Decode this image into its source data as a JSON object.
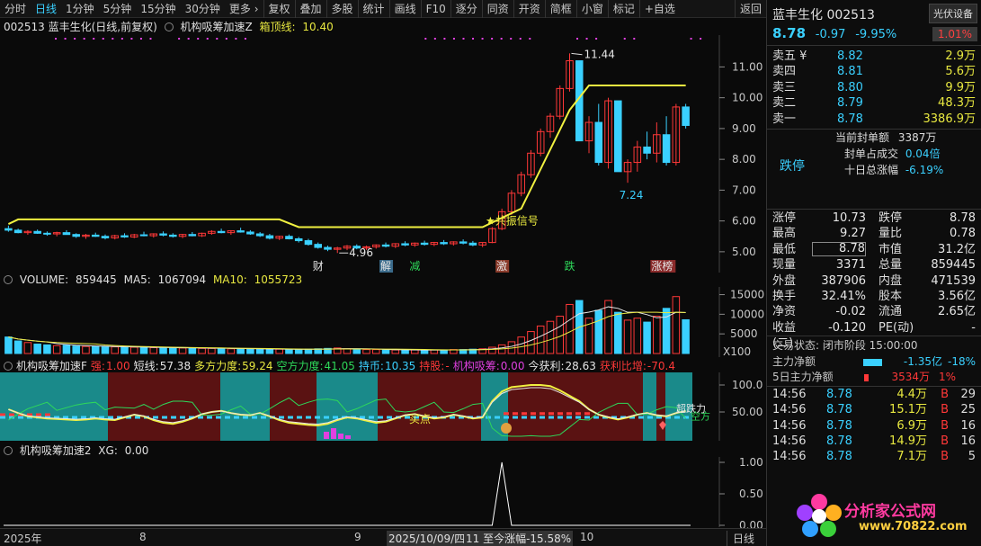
{
  "toolbar": {
    "items": [
      "分时",
      "日线",
      "1分钟",
      "5分钟",
      "15分钟",
      "30分钟",
      "更多 ›",
      "复权",
      "叠加",
      "多股",
      "统计",
      "画线",
      "F10",
      "逐分",
      "同资",
      "开资",
      "简框",
      "小窗",
      "标记",
      "+自选",
      "返回"
    ],
    "active_index": 1
  },
  "main_title": {
    "stock": "002513 蓝丰生化(日线,前复权)",
    "indicator": "机构吸筹加速Z",
    "box_top_label": "箱顶线:",
    "box_top_value": "10.40"
  },
  "price_chart": {
    "y_ticks": [
      "11.00",
      "10.00",
      "9.00",
      "8.00",
      "7.00",
      "6.00",
      "5.00"
    ],
    "high_label": "11.44",
    "low_label": "4.96",
    "low_label2": "7.24",
    "signal_label": "★共振信号",
    "markers": [
      "财",
      "解",
      "减",
      "激",
      "跌",
      "涨榜"
    ]
  },
  "volume_panel": {
    "label": "VOLUME:",
    "value": "859445",
    "ma5_label": "MA5:",
    "ma5_value": "1067094",
    "ma10_label": "MA10:",
    "ma10_value": "1055723",
    "y_ticks": [
      "15000",
      "10000",
      "5000"
    ],
    "unit": "X100"
  },
  "indicator_panel": {
    "name": "机构吸筹加速F",
    "items": [
      {
        "label": "强:",
        "value": "1.00",
        "color": "#ff3838"
      },
      {
        "label": "短线:",
        "value": "57.38",
        "color": "#e6e6e6"
      },
      {
        "label": "多方力度:",
        "value": "59.24",
        "color": "#e8e840"
      },
      {
        "label": "空方力度:",
        "value": "41.05",
        "color": "#2ed85a"
      },
      {
        "label": "持币:",
        "value": "10.35",
        "color": "#3ad0ff"
      },
      {
        "label": "持股:",
        "value": "-",
        "color": "#ff3838"
      },
      {
        "label": "机构吸筹:",
        "value": "0.00",
        "color": "#e040e0"
      },
      {
        "label": "今获利:",
        "value": "28.63",
        "color": "#e6e6e6"
      },
      {
        "label": "获利比增:",
        "value": "-70.4",
        "color": "#ff3838"
      }
    ],
    "y_ticks": [
      "100.0",
      "50.00"
    ],
    "buy_label": "买点",
    "tag1": "超跌力",
    "tag2": "空方"
  },
  "xg_panel": {
    "name": "机构吸筹加速2",
    "label": "XG:",
    "value": "0.00",
    "y_ticks": [
      "1.00",
      "0.50",
      "0.00"
    ]
  },
  "xaxis": {
    "labels": [
      "2025年",
      "8",
      "9",
      "2025/10/09/四",
      "11 至今涨幅-15.58%",
      "10"
    ],
    "period": "日线"
  },
  "quote": {
    "name": "蓝丰生化 002513",
    "sector": "光伏设备",
    "price": "8.78",
    "change": "-0.97",
    "change_pct": "-9.95%",
    "badge_pct": "1.01%",
    "asks": [
      {
        "label": "卖五 ¥",
        "price": "8.82",
        "vol": "2.9万"
      },
      {
        "label": "卖四",
        "price": "8.81",
        "vol": "5.6万"
      },
      {
        "label": "卖三",
        "price": "8.80",
        "vol": "9.9万"
      },
      {
        "label": "卖二",
        "price": "8.79",
        "vol": "48.3万"
      },
      {
        "label": "卖一",
        "price": "8.78",
        "vol": "3386.9万"
      }
    ],
    "seal_label": "当前封单额",
    "seal_value": "3387万",
    "seal_ratio_label": "封单占成交",
    "seal_ratio_value": "0.04倍",
    "ten_day_label": "十日总涨幅",
    "ten_day_value": "-6.19%",
    "status": "跌停",
    "stats": [
      [
        "涨停",
        "10.73",
        "跌停",
        "8.78"
      ],
      [
        "最高",
        "9.27",
        "量比",
        "0.78"
      ],
      [
        "最低",
        "8.78",
        "市值",
        "31.2亿"
      ],
      [
        "现量",
        "3371",
        "总量",
        "859445"
      ],
      [
        "外盘",
        "387906",
        "内盘",
        "471539"
      ],
      [
        "换手",
        "32.41%",
        "股本",
        "3.56亿"
      ],
      [
        "净资",
        "-0.02",
        "流通",
        "2.65亿"
      ],
      [
        "收益(二)",
        "-0.120",
        "PE(动)",
        "-"
      ]
    ],
    "trade_state": "交易状态: 闭市阶段 15:00:00",
    "main_flow_label": "主力净额",
    "main_flow_value": "-1.35亿",
    "main_flow_pct": "-18%",
    "five_day_label": "5日主力净额",
    "five_day_value": "3534万",
    "five_day_pct": "1%",
    "ticks": [
      [
        "14:56",
        "8.78",
        "4.4万",
        "B",
        "29"
      ],
      [
        "14:56",
        "8.78",
        "15.1万",
        "B",
        "25"
      ],
      [
        "14:56",
        "8.78",
        "6.9万",
        "B",
        "16"
      ],
      [
        "14:56",
        "8.78",
        "14.9万",
        "B",
        "16"
      ],
      [
        "14:56",
        "8.78",
        "7.1万",
        "B",
        "5"
      ]
    ],
    "watermark": "分析家公式网",
    "watermark_url": "www.70822.com"
  },
  "chart_data": {
    "type": "candlestick",
    "y_ticks": [
      "11.00",
      "10.00",
      "9.00",
      "8.00",
      "7.00",
      "6.00",
      "5.00"
    ],
    "ylim": [
      4.5,
      11.8
    ],
    "candles": [
      [
        5.75,
        5.85,
        5.65,
        5.7
      ],
      [
        5.7,
        5.75,
        5.6,
        5.62
      ],
      [
        5.62,
        5.7,
        5.55,
        5.66
      ],
      [
        5.66,
        5.72,
        5.58,
        5.6
      ],
      [
        5.6,
        5.66,
        5.52,
        5.58
      ],
      [
        5.58,
        5.65,
        5.5,
        5.62
      ],
      [
        5.62,
        5.7,
        5.55,
        5.56
      ],
      [
        5.56,
        5.6,
        5.45,
        5.5
      ],
      [
        5.5,
        5.58,
        5.42,
        5.54
      ],
      [
        5.54,
        5.62,
        5.48,
        5.5
      ],
      [
        5.5,
        5.56,
        5.4,
        5.45
      ],
      [
        5.45,
        5.55,
        5.4,
        5.52
      ],
      [
        5.52,
        5.6,
        5.45,
        5.48
      ],
      [
        5.48,
        5.58,
        5.44,
        5.55
      ],
      [
        5.55,
        5.65,
        5.5,
        5.52
      ],
      [
        5.52,
        5.6,
        5.46,
        5.58
      ],
      [
        5.58,
        5.66,
        5.5,
        5.54
      ],
      [
        5.54,
        5.6,
        5.46,
        5.5
      ],
      [
        5.5,
        5.58,
        5.44,
        5.56
      ],
      [
        5.56,
        5.64,
        5.5,
        5.52
      ],
      [
        5.52,
        5.62,
        5.48,
        5.6
      ],
      [
        5.6,
        5.7,
        5.55,
        5.66
      ],
      [
        5.66,
        5.75,
        5.6,
        5.62
      ],
      [
        5.62,
        5.7,
        5.55,
        5.68
      ],
      [
        5.68,
        5.78,
        5.62,
        5.64
      ],
      [
        5.64,
        5.7,
        5.55,
        5.58
      ],
      [
        5.58,
        5.64,
        5.48,
        5.52
      ],
      [
        5.52,
        5.58,
        5.4,
        5.44
      ],
      [
        5.44,
        5.52,
        5.38,
        5.5
      ],
      [
        5.5,
        5.56,
        5.4,
        5.42
      ],
      [
        5.42,
        5.48,
        5.3,
        5.36
      ],
      [
        5.36,
        5.42,
        5.2,
        5.24
      ],
      [
        5.24,
        5.3,
        5.1,
        5.14
      ],
      [
        5.14,
        5.2,
        5.02,
        5.08
      ],
      [
        5.08,
        5.16,
        4.96,
        5.12
      ],
      [
        5.12,
        5.22,
        5.05,
        5.18
      ],
      [
        5.18,
        5.24,
        5.08,
        5.12
      ],
      [
        5.12,
        5.2,
        5.06,
        5.16
      ],
      [
        5.16,
        5.24,
        5.1,
        5.22
      ],
      [
        5.22,
        5.3,
        5.14,
        5.18
      ],
      [
        5.18,
        5.28,
        5.12,
        5.26
      ],
      [
        5.26,
        5.34,
        5.18,
        5.22
      ],
      [
        5.22,
        5.3,
        5.16,
        5.28
      ],
      [
        5.28,
        5.36,
        5.2,
        5.24
      ],
      [
        5.24,
        5.32,
        5.18,
        5.3
      ],
      [
        5.3,
        5.38,
        5.22,
        5.26
      ],
      [
        5.26,
        5.34,
        5.2,
        5.32
      ],
      [
        5.32,
        5.4,
        5.24,
        5.28
      ],
      [
        5.28,
        5.35,
        5.18,
        5.22
      ],
      [
        5.22,
        5.3,
        5.15,
        5.3
      ],
      [
        5.3,
        5.8,
        5.28,
        5.75
      ],
      [
        5.75,
        6.4,
        5.7,
        6.3
      ],
      [
        6.3,
        7.0,
        6.2,
        6.9
      ],
      [
        6.9,
        7.6,
        6.8,
        7.5
      ],
      [
        7.5,
        8.3,
        7.4,
        8.2
      ],
      [
        8.2,
        9.0,
        8.1,
        8.9
      ],
      [
        8.9,
        9.5,
        8.7,
        9.4
      ],
      [
        9.4,
        10.4,
        9.3,
        10.3
      ],
      [
        10.3,
        11.44,
        10.2,
        11.2
      ],
      [
        11.2,
        10.4,
        8.6,
        8.6
      ],
      [
        8.6,
        9.4,
        8.2,
        9.2
      ],
      [
        9.2,
        9.8,
        7.8,
        7.9
      ],
      [
        7.9,
        10.0,
        7.7,
        9.9
      ],
      [
        9.9,
        8.2,
        7.6,
        7.6
      ],
      [
        7.6,
        8.0,
        7.24,
        7.9
      ],
      [
        7.9,
        8.6,
        7.6,
        8.4
      ],
      [
        8.4,
        8.9,
        8.0,
        8.2
      ],
      [
        8.2,
        9.2,
        7.9,
        8.8
      ],
      [
        8.8,
        9.4,
        7.8,
        7.9
      ],
      [
        7.9,
        9.8,
        7.8,
        9.7
      ],
      [
        9.7,
        9.8,
        9.0,
        9.1
      ]
    ],
    "box_line": [
      [
        0,
        5.9
      ],
      [
        1,
        6.05
      ],
      [
        2,
        6.05
      ],
      [
        25,
        6.05
      ],
      [
        28,
        6.05
      ],
      [
        30,
        5.8
      ],
      [
        49,
        5.8
      ],
      [
        53,
        6.4
      ],
      [
        58,
        9.6
      ],
      [
        60,
        10.4
      ],
      [
        70,
        10.4
      ]
    ],
    "volume": [
      4200,
      3200,
      2800,
      2400,
      2200,
      2000,
      2100,
      1900,
      1800,
      1800,
      1700,
      1700,
      1600,
      1600,
      1500,
      1500,
      1500,
      1400,
      1400,
      1400,
      1300,
      1300,
      1300,
      1200,
      1200,
      1200,
      1100,
      1100,
      1100,
      1000,
      1000,
      1100,
      1200,
      1300,
      1400,
      1200,
      1100,
      1000,
      1000,
      900,
      900,
      900,
      900,
      900,
      900,
      900,
      1000,
      1000,
      1100,
      1200,
      1600,
      2200,
      3000,
      4200,
      5600,
      7000,
      8200,
      9500,
      12500,
      13500,
      9000,
      11000,
      13500,
      10500,
      8500,
      9000,
      8000,
      9500,
      11500,
      14500,
      8600
    ],
    "xg_peak_index": 45
  }
}
